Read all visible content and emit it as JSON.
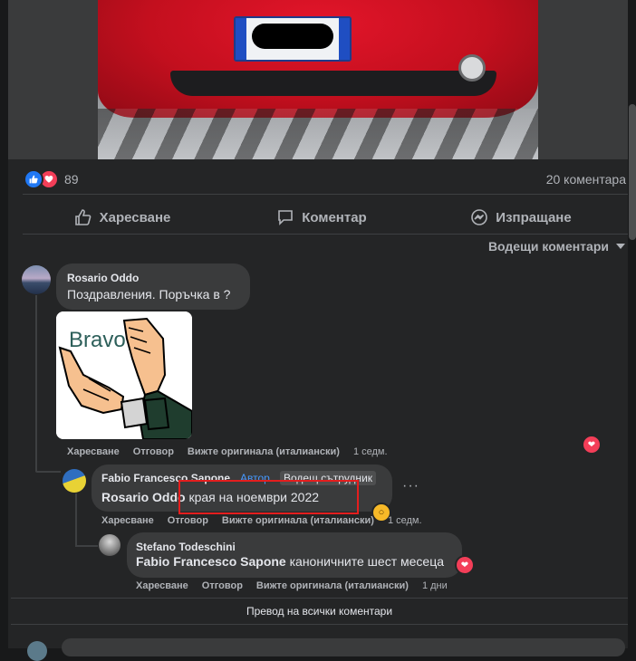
{
  "post": {
    "reaction_count": "89",
    "comment_count": "20 коментара",
    "actions": {
      "like": "Харесване",
      "comment": "Коментар",
      "share": "Изпращане"
    },
    "sort_label": "Водещи коментари"
  },
  "comments": [
    {
      "author": "Rosario Oddo",
      "text": "Поздравления. Поръчка в ?",
      "sticker_text": "Bravo",
      "meta": {
        "like": "Харесване",
        "reply": "Отговор",
        "translate": "Вижте оригинала (италиански)",
        "time": "1 седм."
      }
    },
    {
      "author": "Fabio Francesco Sapone",
      "badge_author": "Автор",
      "badge_lead": "Водещ сътрудник",
      "mention": "Rosario Oddo",
      "text": "края на ноември 2022",
      "meta": {
        "like": "Харесване",
        "reply": "Отговор",
        "translate": "Вижте оригинала (италиански)",
        "time": "1 седм."
      }
    },
    {
      "author": "Stefano Todeschini",
      "mention": "Fabio Francesco Sapone",
      "text": "каноничните шест месеца",
      "meta": {
        "like": "Харесване",
        "reply": "Отговор",
        "translate": "Вижте оригинала (италиански)",
        "time": "1 дни"
      }
    }
  ],
  "translate_all": "Превод на всички коментари",
  "icons": {
    "like": "thumbs-up-icon",
    "comment": "speech-bubble-icon",
    "share": "messenger-icon",
    "love": "heart-icon",
    "wow": "wow-face-icon"
  },
  "colors": {
    "background": "#18191a",
    "card": "#242526",
    "bubble": "#3a3b3c",
    "like_blue": "#2078f4",
    "love_red": "#f33e58",
    "author_blue": "#4599ff",
    "highlight_red": "#e41e1e"
  }
}
